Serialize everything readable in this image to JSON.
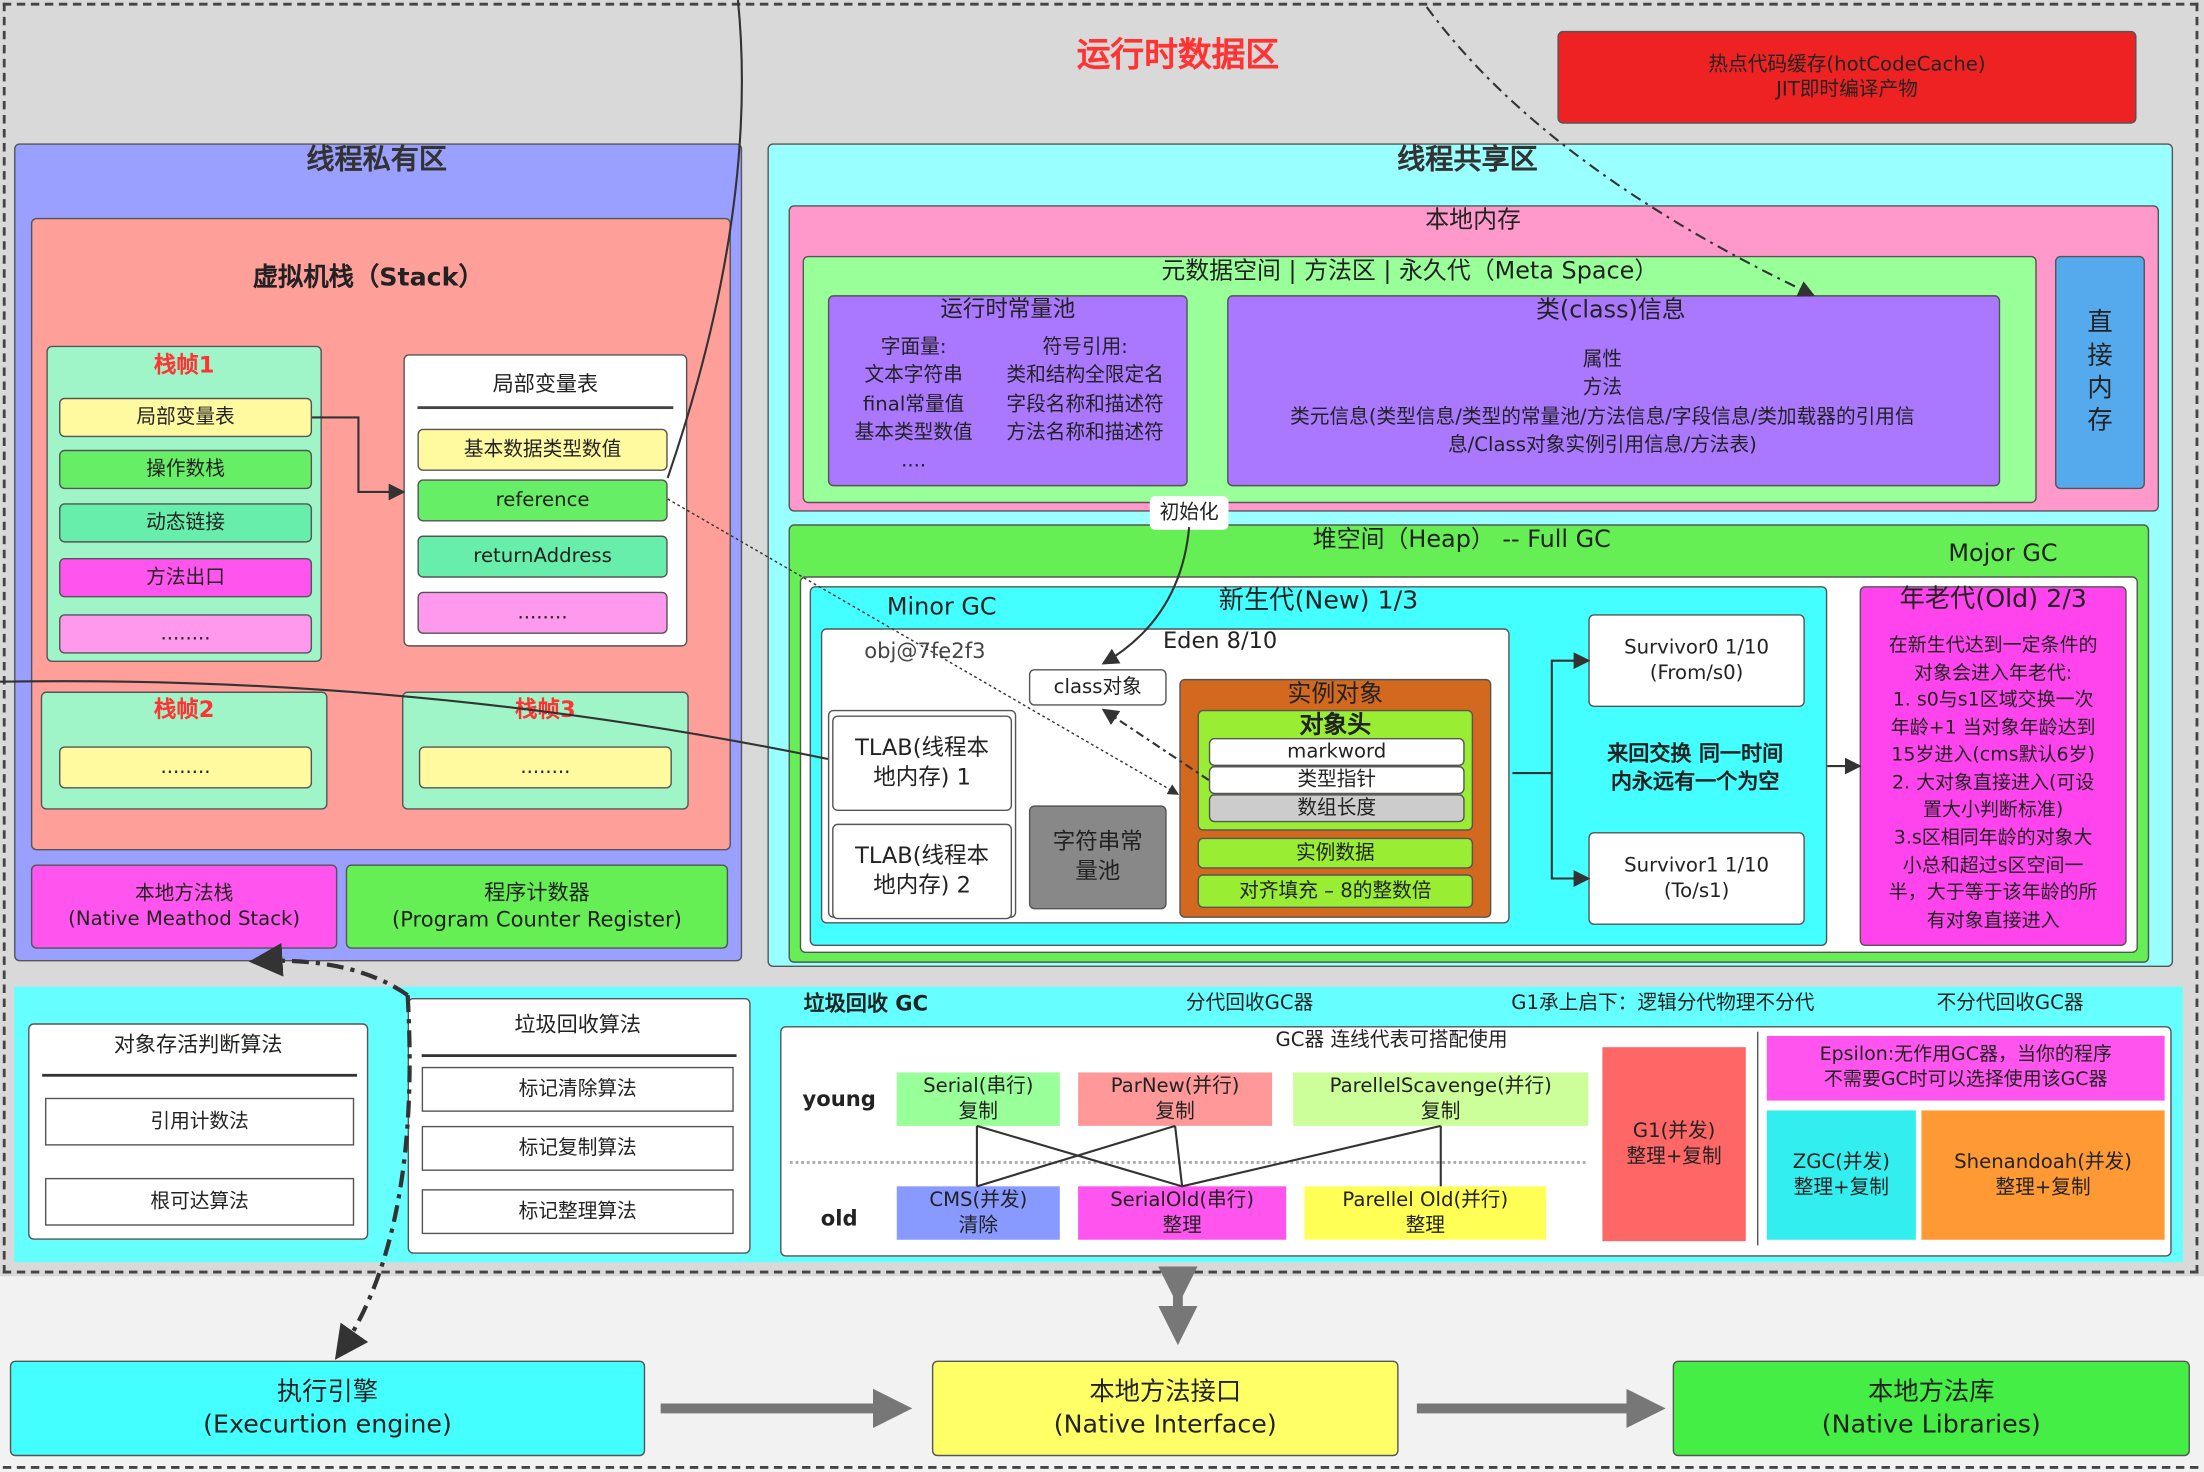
{
  "title": "运行时数据区",
  "hot_code_cache": "热点代码缓存(hotCodeCache)\nJIT即时编译产物",
  "thread_private": {
    "title": "线程私有区",
    "stack": {
      "title": "虚拟机栈（Stack）",
      "frame1": {
        "title": "栈帧1",
        "items": [
          "局部变量表",
          "操作数栈",
          "动态链接",
          "方法出口",
          "........"
        ]
      },
      "local_var_table": {
        "title": "局部变量表",
        "items": [
          "基本数据类型数值",
          "reference",
          "returnAddress",
          "........"
        ]
      },
      "frame2": {
        "title": "栈帧2",
        "item": "........"
      },
      "frame3": {
        "title": "栈帧3",
        "item": "........"
      }
    },
    "native_method_stack": "本地方法栈\n(Native Meathod Stack)",
    "program_counter": "程序计数器\n(Program Counter Register)"
  },
  "thread_shared": {
    "title": "线程共享区",
    "native_memory": {
      "title": "本地内存",
      "meta_space": {
        "title": "元数据空间 | 方法区 | 永久代（Meta Space）",
        "runtime_constant_pool": {
          "title": "运行时常量池",
          "literals": "字面量:\n文本字符串\nfinal常量值\n基本类型数值\n....",
          "symbol_refs": "符号引用:\n类和结构全限定名\n字段名称和描述符\n方法名称和描述符"
        },
        "class_info": {
          "title": "类(class)信息",
          "body": "属性\n方法\n类元信息(类型信息/类型的常量池/方法信息/字段信息/类加载器的引用信\n息/Class对象实例引用信息/方法表)"
        }
      },
      "direct_memory": "直\n接\n内\n存"
    },
    "init_label": "初始化",
    "heap": {
      "title": "堆空间（Heap）  -- Full GC",
      "major_gc": "Mojor GC",
      "minor_gc": "Minor GC",
      "new_gen": {
        "title": "新生代(New)  1/3",
        "eden": {
          "title": "Eden  8/10",
          "obj_ref": "obj@7fe2f3",
          "class_object": "class对象",
          "tlab1": "TLAB(线程本\n地内存) 1",
          "tlab2": "TLAB(线程本\n地内存) 2",
          "string_pool": "字符串常\n量池",
          "instance": {
            "title": "实例对象",
            "header": {
              "title": "对象头",
              "items": [
                "markword",
                "类型指针",
                "数组长度"
              ]
            },
            "data": "实例数据",
            "padding": "对齐填充 – 8的整数倍"
          }
        },
        "survivor0": "Survivor0   1/10\n(From/s0)",
        "survivor1": "Survivor1   1/10\n(To/s1)",
        "swap_note": "来回交换 同一时间\n内永远有一个为空"
      },
      "old_gen": {
        "title": "年老代(Old)  2/3",
        "body": "在新生代达到一定条件的\n对象会进入年老代:\n1. s0与s1区域交换一次\n年龄+1 当对象年龄达到\n15岁进入(cms默认6岁)\n2. 大对象直接进入(可设\n置大小判断标准)\n3.s区相同年龄的对象大\n小总和超过s区空间一\n半，大于等于该年龄的所\n有对象直接进入"
      }
    }
  },
  "gc": {
    "liveness": {
      "title": "对象存活判断算法",
      "items": [
        "引用计数法",
        "根可达算法"
      ]
    },
    "algorithms": {
      "title": "垃圾回收算法",
      "items": [
        "标记清除算法",
        "标记复制算法",
        "标记整理算法"
      ]
    },
    "header": {
      "title": "垃圾回收 GC",
      "generational": "分代回收GC器",
      "g1_note": "G1承上启下：逻辑分代物理不分代",
      "non_generational": "不分代回收GC器"
    },
    "collectors_title": "GC器  连线代表可搭配使用",
    "young_label": "young",
    "old_label": "old",
    "young": [
      "Serial(串行)\n复制",
      "ParNew(并行)\n复制",
      "ParellelScavenge(并行)\n复制"
    ],
    "old": [
      "CMS(并发)\n清除",
      "SerialOld(串行)\n整理",
      "Parellel Old(并行)\n整理"
    ],
    "g1": "G1(并发)\n整理+复制",
    "epsilon": "Epsilon:无作用GC器，当你的程序\n不需要GC时可以选择使用该GC器",
    "zgc": "ZGC(并发)\n整理+复制",
    "shenandoah": "Shenandoah(并发)\n整理+复制"
  },
  "bottom": {
    "execution_engine": "执行引擎\n(Execurtion engine)",
    "native_interface": "本地方法接口\n(Native Interface)",
    "native_libraries": "本地方法库\n(Native Libraries)"
  },
  "colors": {
    "title": "#ff3333",
    "frame_title": "#ff3333",
    "hot_code": "#ee2222",
    "thread_private": "#9aa0ff",
    "stack": "#ff9f9a",
    "thread_shared": "#99ffff",
    "heap": "#66ee55",
    "new_gen": "#44ffff",
    "old_gen": "#ff44ee",
    "instance": "#d2691e"
  }
}
